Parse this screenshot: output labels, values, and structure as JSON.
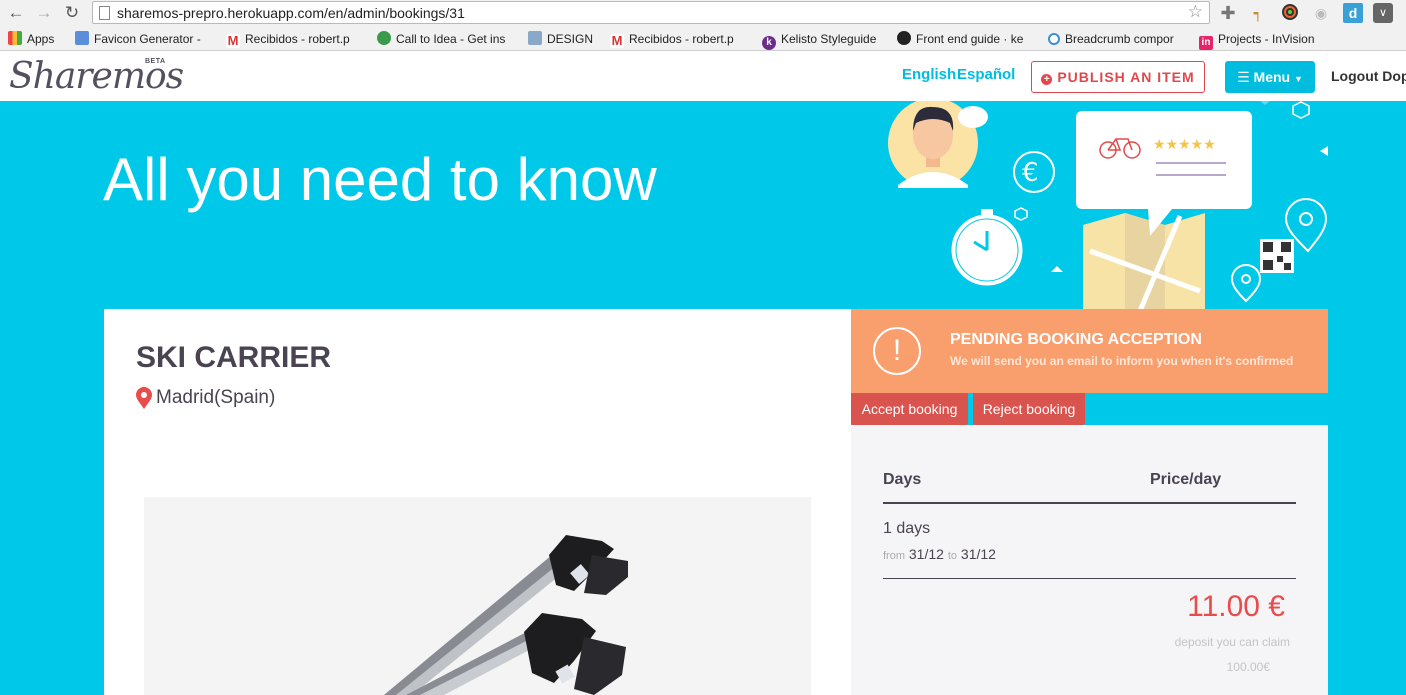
{
  "browser": {
    "url": "sharemos-prepro.herokuapp.com/en/admin/bookings/31",
    "bookmarks": [
      {
        "label": "Apps",
        "icon": "apps-grid-icon"
      },
      {
        "label": "Favicon Generator -",
        "icon": "favicon-generator-icon"
      },
      {
        "label": "Recibidos - robert.p",
        "icon": "gmail-icon"
      },
      {
        "label": "Call to Idea - Get ins",
        "icon": "leaf-icon"
      },
      {
        "label": "DESIGN",
        "icon": "folder-icon"
      },
      {
        "label": "Recibidos - robert.p",
        "icon": "gmail-icon"
      },
      {
        "label": "Kelisto Styleguide",
        "icon": "kelisto-icon"
      },
      {
        "label": "Front end guide · ke",
        "icon": "github-icon"
      },
      {
        "label": "Breadcrumb compor",
        "icon": "spinner-icon"
      },
      {
        "label": "Projects - InVision",
        "icon": "invision-icon"
      }
    ]
  },
  "header": {
    "logo": "Sharemos",
    "beta": "BETA",
    "lang_en": "English",
    "lang_es": "Español",
    "publish_label": "PUBLISH AN ITEM",
    "menu_label": "Menu",
    "logout_label": "Logout Dope"
  },
  "hero": {
    "title": "All you need to know"
  },
  "item": {
    "title": "SKI CARRIER",
    "location": "Madrid(Spain)"
  },
  "status": {
    "icon": "!",
    "title": "PENDING BOOKING ACCEPTION",
    "subtitle": "We will send you an email to inform you when it's confirmed"
  },
  "actions": {
    "accept": "Accept booking",
    "reject": "Reject booking"
  },
  "pricing": {
    "col_days": "Days",
    "col_price": "Price/day",
    "days": "1 days",
    "from_label": "from",
    "from_date": "31/12",
    "to_label": "to",
    "to_date": "31/12",
    "price": "11.00 €",
    "deposit_label": "deposit you can claim",
    "deposit_amount": "100.00€"
  },
  "colors": {
    "accent": "#00c8e8",
    "publish": "#e2474b",
    "pending": "#f99f6e",
    "action": "#d9534f",
    "price": "#ea4b4b"
  }
}
